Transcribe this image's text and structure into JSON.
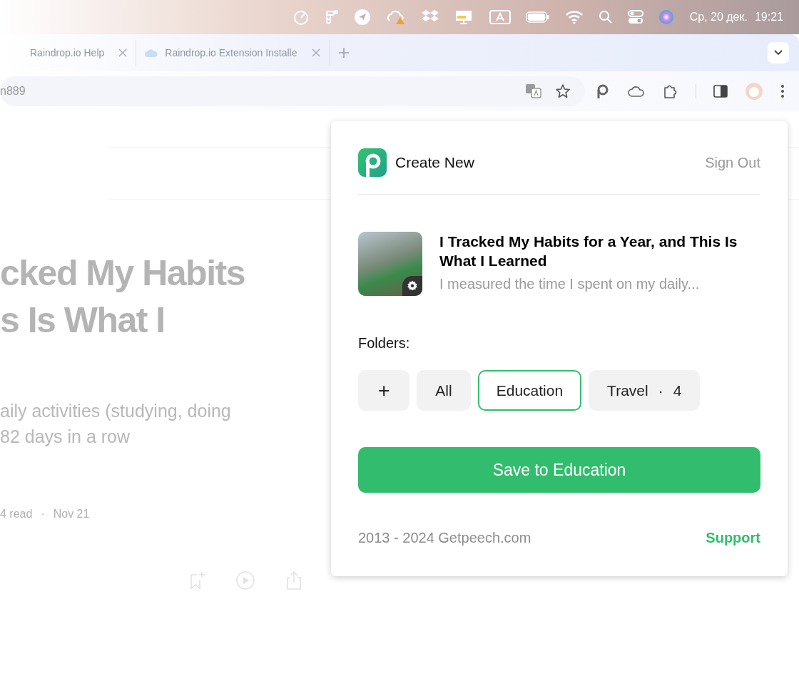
{
  "menu_bar": {
    "date": "Ср, 20 дек.",
    "time": "19:21"
  },
  "tabs": [
    {
      "label": "Raindrop.io Help",
      "selected": false
    },
    {
      "label": "Raindrop.io Extension Installe",
      "selected": false
    }
  ],
  "address_bar": {
    "value": "n889"
  },
  "article": {
    "title_lines": [
      "cked My Habits",
      "s Is What I"
    ],
    "subtitle_lines": [
      "aily activities (studying, doing",
      "82 days in a row"
    ],
    "read_time": "4 read",
    "separator": "·",
    "date": "Nov 21"
  },
  "popup": {
    "title": "Create New",
    "sign_out": "Sign Out",
    "bookmark": {
      "title": "I Tracked My Habits for a Year, and This Is What I Learned",
      "description": "I measured the time I spent on my daily..."
    },
    "folders_label": "Folders:",
    "folders": [
      {
        "kind": "add",
        "label": "+",
        "selected": false
      },
      {
        "kind": "folder",
        "label": "All",
        "selected": false
      },
      {
        "kind": "folder",
        "label": "Education",
        "selected": true
      },
      {
        "kind": "folder",
        "label": "Travel",
        "separator": "·",
        "count": "4",
        "selected": false
      }
    ],
    "save_button": "Save to Education",
    "footer": {
      "copyright": "2013 - 2024 Getpeech.com",
      "support": "Support"
    }
  }
}
